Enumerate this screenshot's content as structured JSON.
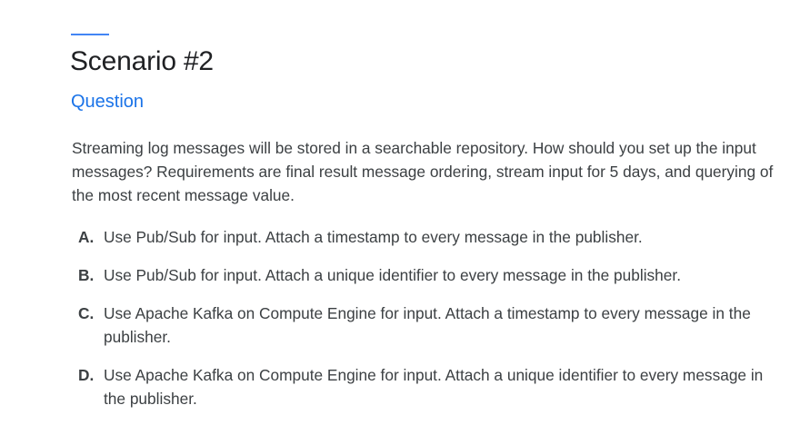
{
  "colors": {
    "accent": "#4285f4",
    "subtitle": "#1a73e8",
    "text": "#3c4043",
    "title": "#202124"
  },
  "slide": {
    "title": "Scenario #2",
    "subtitle": "Question",
    "question": "Streaming log messages will be stored in a searchable repository. How should you set up the input messages? Requirements are final result message ordering, stream input for 5 days, and querying of the most recent message value.",
    "options": [
      {
        "letter": "A.",
        "text": "Use Pub/Sub for input. Attach a timestamp to every message in the publisher."
      },
      {
        "letter": "B.",
        "text": "Use Pub/Sub for input. Attach a unique identifier to every message in the publisher."
      },
      {
        "letter": "C.",
        "text": "Use Apache Kafka on Compute Engine for input. Attach a timestamp to every message in the publisher."
      },
      {
        "letter": "D.",
        "text": "Use Apache Kafka on Compute Engine for input. Attach a unique identifier to every message in the publisher."
      }
    ]
  }
}
